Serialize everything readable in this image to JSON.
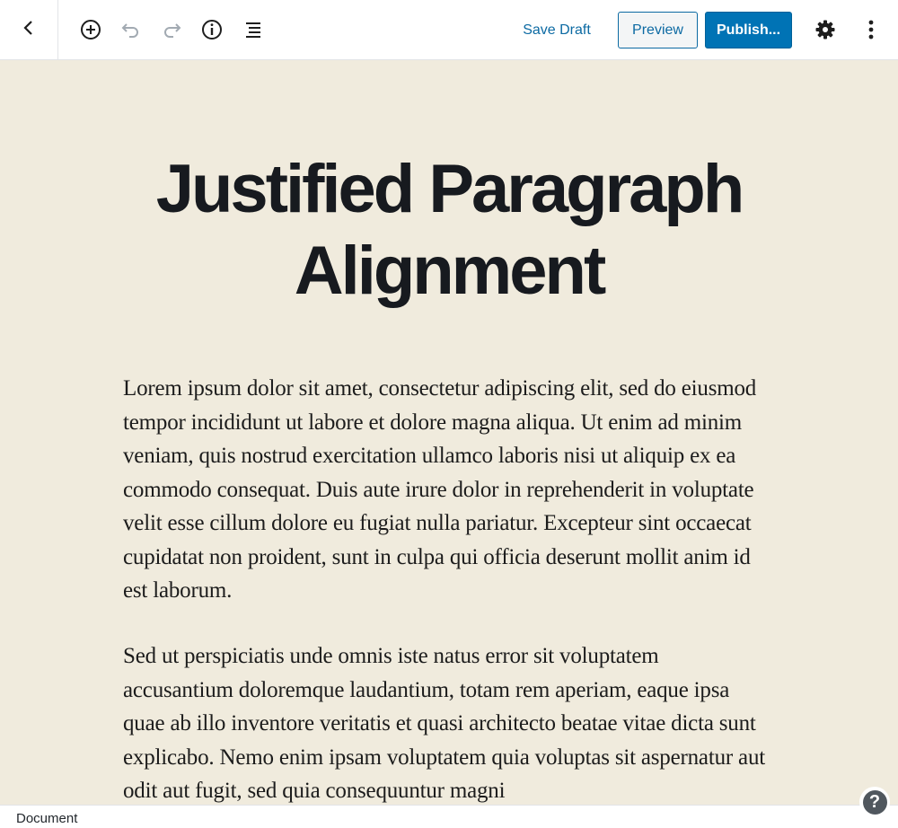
{
  "toolbar": {
    "back_icon": "chevron-left-icon",
    "add_block_icon": "plus-circle-icon",
    "undo_icon": "undo-icon",
    "redo_icon": "redo-icon",
    "info_icon": "info-icon",
    "outline_icon": "list-outline-icon",
    "save_draft_label": "Save Draft",
    "preview_label": "Preview",
    "publish_label": "Publish...",
    "settings_icon": "gear-icon",
    "more_icon": "vertical-ellipsis-icon"
  },
  "post": {
    "title": "Justified Paragraph Alignment",
    "paragraphs": [
      "Lorem ipsum dolor sit amet, consectetur adipiscing elit, sed do eiusmod tempor incididunt ut labore et dolore magna aliqua. Ut enim ad minim veniam, quis nostrud exercitation ullamco laboris nisi ut aliquip ex ea commodo consequat. Duis aute irure dolor in reprehenderit in voluptate velit esse cillum dolore eu fugiat nulla pariatur. Excepteur sint occaecat cupidatat non proident, sunt in culpa qui officia deserunt mollit anim id est laborum.",
      "Sed ut perspiciatis unde omnis iste natus error sit voluptatem accusantium doloremque laudantium, totam rem aperiam, eaque ipsa quae ab illo inventore veritatis et quasi architecto beatae vitae dicta sunt explicabo. Nemo enim ipsam voluptatem quia voluptas sit aspernatur aut odit aut fugit, sed quia consequuntur magni"
    ]
  },
  "statusbar": {
    "breadcrumb_label": "Document"
  },
  "help": {
    "icon": "help-icon",
    "glyph": "?"
  },
  "colors": {
    "canvas_background": "#f0ebdd",
    "accent": "#0073b5",
    "title_text": "#171a1f"
  }
}
